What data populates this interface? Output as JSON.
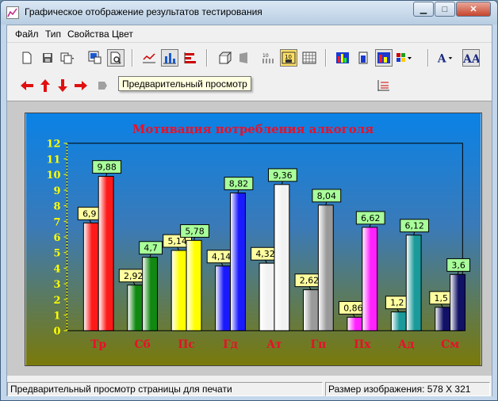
{
  "window": {
    "title": "Графическое отображение результатов тестирования"
  },
  "menu": [
    {
      "label": "Файл"
    },
    {
      "label": "Тип"
    },
    {
      "label": "Свойства"
    },
    {
      "label": "Цвет"
    }
  ],
  "toolbar": {
    "tooltip": "Предварительный просмотр",
    "spin_left_value": "0",
    "spin_right_value": "12"
  },
  "status": {
    "left": "Предварительный просмотр страницы для печати",
    "right": "Размер изображения: 578 X 321"
  },
  "colors": {
    "title_red": "#e8102a",
    "axis_yellow": "#ffff00",
    "label_bg": "#ffffa0",
    "label_bg_green": "#a8ff9a"
  },
  "chart_data": {
    "type": "bar",
    "title": "Мотивация потребления алкоголя",
    "categories": [
      "Тр",
      "Сб",
      "Пс",
      "Гд",
      "Ат",
      "Гп",
      "Пх",
      "Ад",
      "См"
    ],
    "series": [
      {
        "values": [
          6.9,
          2.92,
          5.14,
          4.14,
          4.32,
          2.62,
          0.86,
          1.2,
          1.5
        ]
      },
      {
        "values": [
          9.88,
          4.7,
          5.78,
          8.82,
          9.36,
          8.04,
          6.62,
          6.12,
          3.6
        ]
      }
    ],
    "value_labels": [
      [
        "6,9",
        "2,92",
        "5,14",
        "4,14",
        "4,32",
        "2,62",
        "0,86",
        "1,2",
        "1,5"
      ],
      [
        "9,88",
        "4,7",
        "5,78",
        "8,82",
        "9,36",
        "8,04",
        "6,62",
        "6,12",
        "3,6"
      ]
    ],
    "y_ticks": [
      "0",
      "1",
      "2",
      "3",
      "4",
      "5",
      "6",
      "7",
      "8",
      "9",
      "10",
      "11",
      "12"
    ],
    "ylim": [
      0,
      12
    ],
    "bar_colors": [
      "#ff1a1a",
      "#118811",
      "#ffff00",
      "#1a1aff",
      "#f2f2f2",
      "#9a9a9a",
      "#ff22ff",
      "#1a9a9a",
      "#111166"
    ],
    "grid": false
  }
}
